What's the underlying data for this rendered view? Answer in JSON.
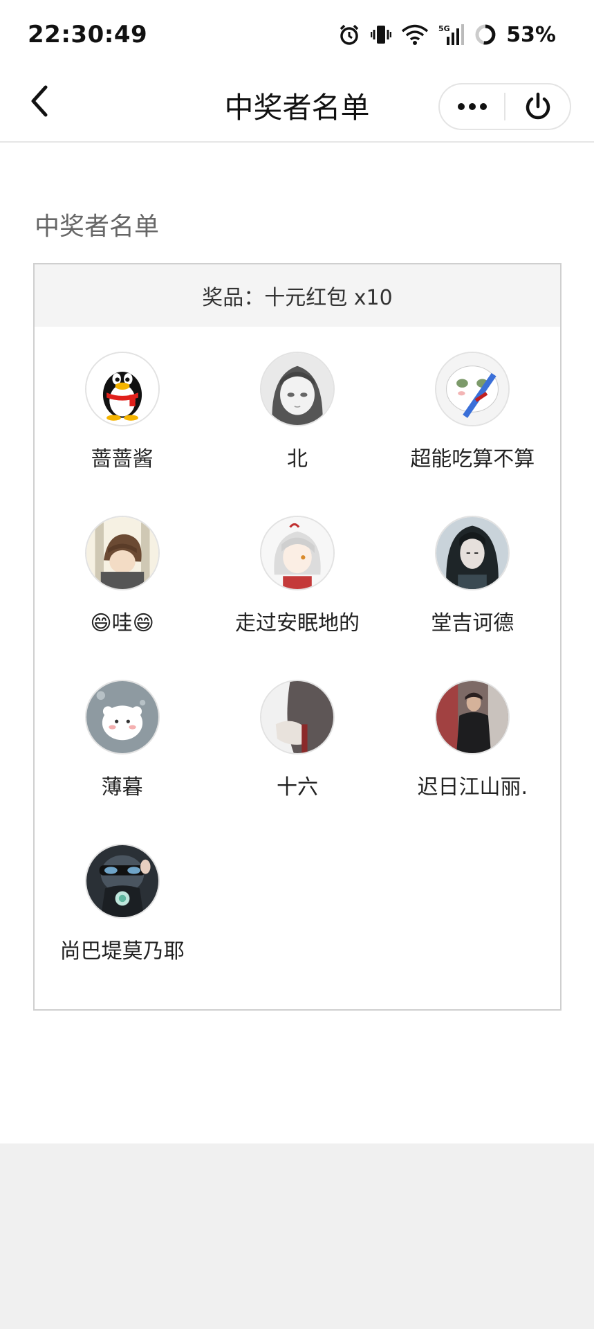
{
  "status_bar": {
    "time": "22:30:49",
    "battery": "53%",
    "icons": [
      "alarm-icon",
      "vibrate-icon",
      "wifi-icon",
      "5g-signal-icon",
      "battery-ring-icon"
    ]
  },
  "nav": {
    "title": "中奖者名单",
    "back_icon": "chevron-left-icon",
    "more_icon": "more-dots-icon",
    "close_icon": "power-icon"
  },
  "section": {
    "heading": "中奖者名单"
  },
  "prize": {
    "label": "奖品：十元红包 x10"
  },
  "winners": [
    {
      "name": "蔷蔷酱",
      "avatar": "penguin-avatar"
    },
    {
      "name": "北",
      "avatar": "anime-girl-avatar"
    },
    {
      "name": "超能吃算不算",
      "avatar": "meme-face-avatar"
    },
    {
      "name": "😄哇😄",
      "avatar": "anime-boy-avatar"
    },
    {
      "name": "走过安眠地的",
      "avatar": "white-hair-anime-avatar"
    },
    {
      "name": "堂吉诃德",
      "avatar": "dark-hair-anime-avatar"
    },
    {
      "name": "薄暮",
      "avatar": "fluffy-creature-avatar"
    },
    {
      "name": "十六",
      "avatar": "hand-photo-avatar"
    },
    {
      "name": "迟日江山丽.",
      "avatar": "person-leather-jacket-avatar"
    },
    {
      "name": "尚巴堤莫乃耶",
      "avatar": "masked-person-avatar"
    }
  ],
  "colors": {
    "page_bg": "#f0f0f0",
    "card_bg": "#ffffff",
    "header_bg": "#f4f4f4",
    "border": "#cfcfcf"
  }
}
